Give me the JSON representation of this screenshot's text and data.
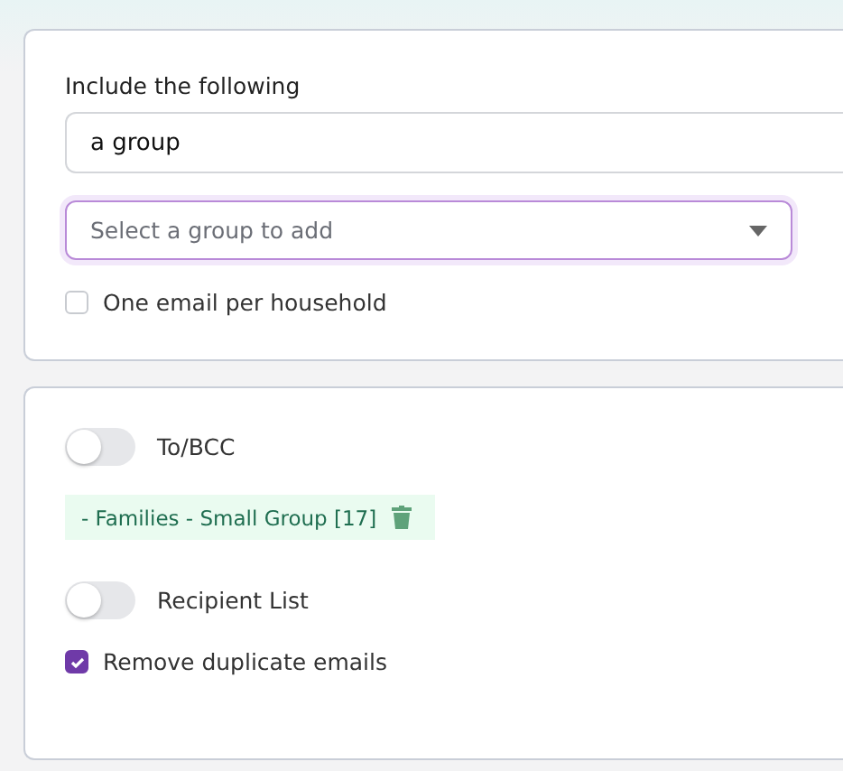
{
  "include": {
    "label": "Include the following",
    "value": "a group",
    "select": {
      "placeholder": "Select a group to add"
    },
    "household": {
      "label": "One email per household",
      "checked": false
    }
  },
  "options": {
    "to_bcc": {
      "label": "To/BCC",
      "on": false
    },
    "groups": [
      {
        "label": "- Families - Small Group [17]"
      }
    ],
    "recipient_list": {
      "label": "Recipient List",
      "on": false
    },
    "remove_duplicates": {
      "label": "Remove duplicate emails",
      "checked": true
    }
  }
}
